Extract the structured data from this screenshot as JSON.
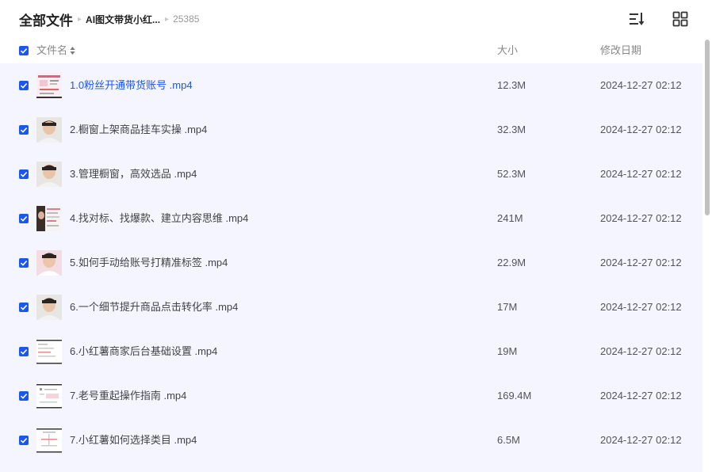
{
  "breadcrumb": {
    "root": "全部文件",
    "folder": "AI图文带货小红...",
    "current": "25385"
  },
  "toolbar": {
    "sort_icon": "sort-list-icon",
    "view_icon": "grid-view-icon"
  },
  "columns": {
    "name": "文件名",
    "size": "大小",
    "modified": "修改日期"
  },
  "colors": {
    "accent": "#1a56f5",
    "row_bg": "#f4f5ff"
  },
  "files": [
    {
      "name": "1.0粉丝开通带货账号 .mp4",
      "size": "12.3M",
      "modified": "2024-12-27 02:12",
      "thumb": "slide-pink",
      "checked": true,
      "highlighted": true
    },
    {
      "name": "2.橱窗上架商品挂车实操 .mp4",
      "size": "32.3M",
      "modified": "2024-12-27 02:12",
      "thumb": "person",
      "checked": true
    },
    {
      "name": "3.管理橱窗，高效选品 .mp4",
      "size": "52.3M",
      "modified": "2024-12-27 02:12",
      "thumb": "person",
      "checked": true
    },
    {
      "name": "4.找对标、找爆款、建立内容思维 .mp4",
      "size": "241M",
      "modified": "2024-12-27 02:12",
      "thumb": "collage",
      "checked": true
    },
    {
      "name": "5.如何手动给账号打精准标签 .mp4",
      "size": "22.9M",
      "modified": "2024-12-27 02:12",
      "thumb": "person-pink",
      "checked": true
    },
    {
      "name": "6.一个细节提升商品点击转化率 .mp4",
      "size": "17M",
      "modified": "2024-12-27 02:12",
      "thumb": "person",
      "checked": true
    },
    {
      "name": "6.小红薯商家后台基础设置 .mp4",
      "size": "19M",
      "modified": "2024-12-27 02:12",
      "thumb": "doc",
      "checked": true
    },
    {
      "name": "7.老号重起操作指南 .mp4",
      "size": "169.4M",
      "modified": "2024-12-27 02:12",
      "thumb": "doc-pink",
      "checked": true
    },
    {
      "name": "7.小红薯如何选择类目 .mp4",
      "size": "6.5M",
      "modified": "2024-12-27 02:12",
      "thumb": "doc",
      "checked": true
    }
  ]
}
